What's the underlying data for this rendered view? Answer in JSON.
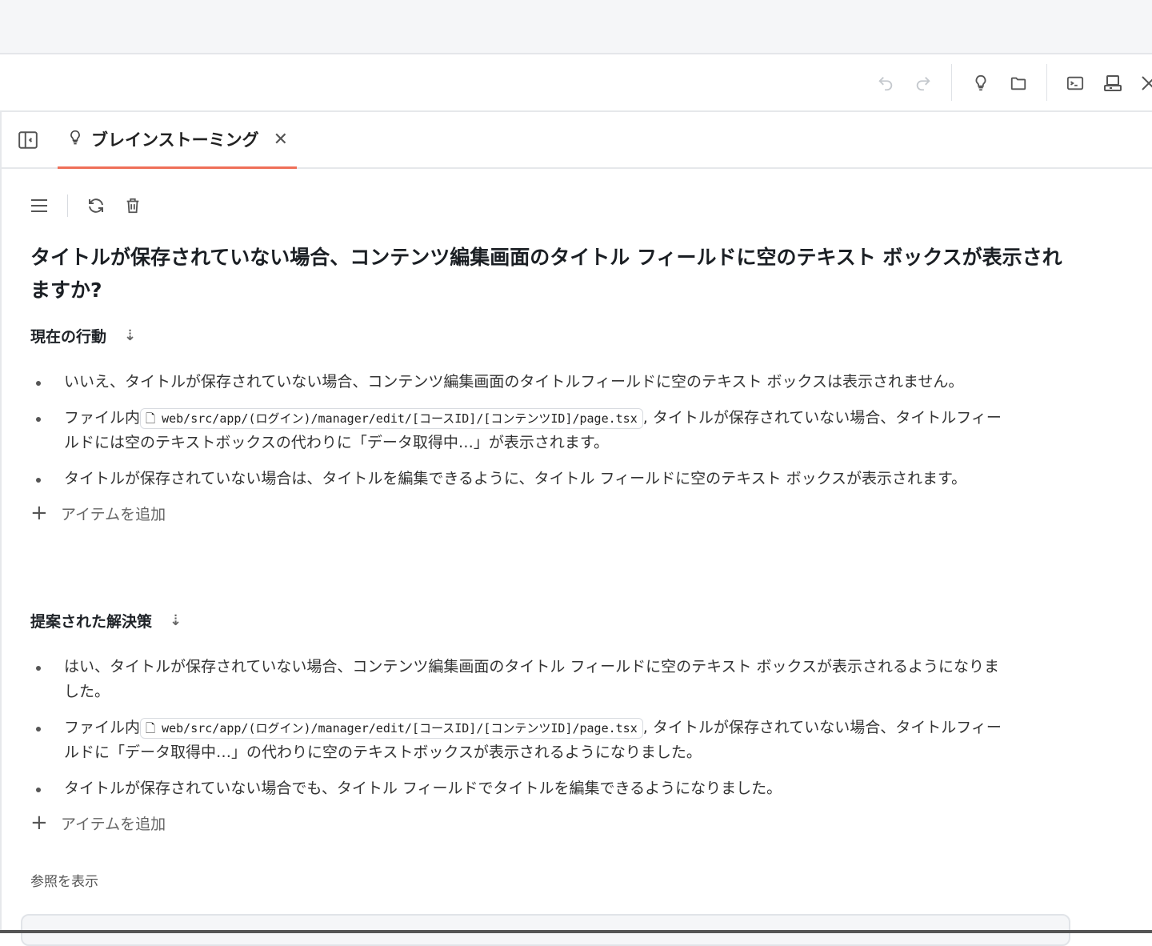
{
  "toolbar": {
    "icons": [
      "undo-icon",
      "redo-icon",
      "lightbulb-icon",
      "folder-icon",
      "terminal-icon",
      "computer-icon",
      "tools-icon"
    ]
  },
  "tab": {
    "label": "ブレインストーミング",
    "icon": "lightbulb-icon"
  },
  "question": "タイトルが保存されていない場合、コンテンツ編集画面のタイトル フィールドに空のテキスト ボックスが表示されますか?",
  "current": {
    "title": "現在の行動",
    "items": [
      {
        "text": "いいえ、タイトルが保存されていない場合、コンテンツ編集画面のタイトルフィールドに空のテキスト ボックスは表示されません。"
      },
      {
        "prefix": "ファイル内",
        "path": "web/src/app/(ログイン)/manager/edit/[コースID]/[コンテンツID]/page.tsx",
        "text": ", タイトルが保存されていない場合、タイトルフィールドには空のテキストボックスの代わりに「データ取得中…」が表示されます。"
      },
      {
        "text": "タイトルが保存されていない場合は、タイトルを編集できるように、タイトル フィールドに空のテキスト ボックスが表示されます。"
      }
    ],
    "add_label": "アイテムを追加"
  },
  "proposed": {
    "title": "提案された解決策",
    "items": [
      {
        "text": "はい、タイトルが保存されていない場合、コンテンツ編集画面のタイトル フィールドに空のテキスト ボックスが表示されるようになりました。"
      },
      {
        "prefix": "ファイル内",
        "path": "web/src/app/(ログイン)/manager/edit/[コースID]/[コンテンツID]/page.tsx",
        "text": ", タイトルが保存されていない場合、タイトルフィールドに「データ取得中…」の代わりに空のテキストボックスが表示されるようになりました。"
      },
      {
        "text": "タイトルが保存されていない場合でも、タイトル フィールドでタイトルを編集できるようになりました。"
      }
    ],
    "add_label": "アイテムを追加"
  },
  "refs_label": "参照を表示",
  "colors": {
    "accent": "#ef6f58"
  }
}
